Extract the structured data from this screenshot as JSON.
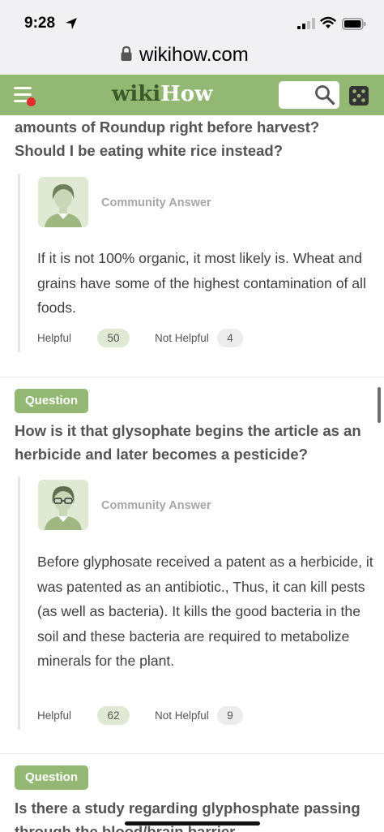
{
  "status_bar": {
    "time": "9:28"
  },
  "url_bar": {
    "domain": "wikihow.com"
  },
  "header": {
    "logo_wiki": "wiki",
    "logo_how": "How",
    "search_placeholder": ""
  },
  "qa": {
    "q0": {
      "title_partial": "amounts of Roundup right before harvest? Should I be eating white rice instead?",
      "answer_label": "Community Answer",
      "answer": "If it is not 100% organic, it most likely is. Wheat and grains have some of the highest contamination of all foods.",
      "helpful_label": "Helpful",
      "helpful_count": "50",
      "not_helpful_label": "Not Helpful",
      "not_helpful_count": "4"
    },
    "q1": {
      "badge": "Question",
      "title": "How is it that glysophate begins the article as an herbicide and later becomes a pesticide?",
      "answer_label": "Community Answer",
      "answer": "Before glyphosate received a patent as a herbicide, it was patented as an antibiotic., Thus, it can kill pests (as well as bacteria). It kills the good bacteria in the soil and these bacteria are required to metabolize minerals for the plant.",
      "helpful_label": "Helpful",
      "helpful_count": "62",
      "not_helpful_label": "Not Helpful",
      "not_helpful_count": "9"
    },
    "q2": {
      "badge": "Question",
      "title_partial": "Is there a study regarding glyphosphate passing through the blood/brain barrier"
    }
  },
  "colors": {
    "brand_green": "#93b874",
    "logo_dark_green": "#3d5a2a",
    "notification_dot": "#e22b2b"
  },
  "icons": [
    "location-arrow-icon",
    "signal-icon",
    "wifi-icon",
    "battery-icon",
    "lock-icon",
    "menu-icon",
    "search-icon",
    "dice-icon"
  ]
}
